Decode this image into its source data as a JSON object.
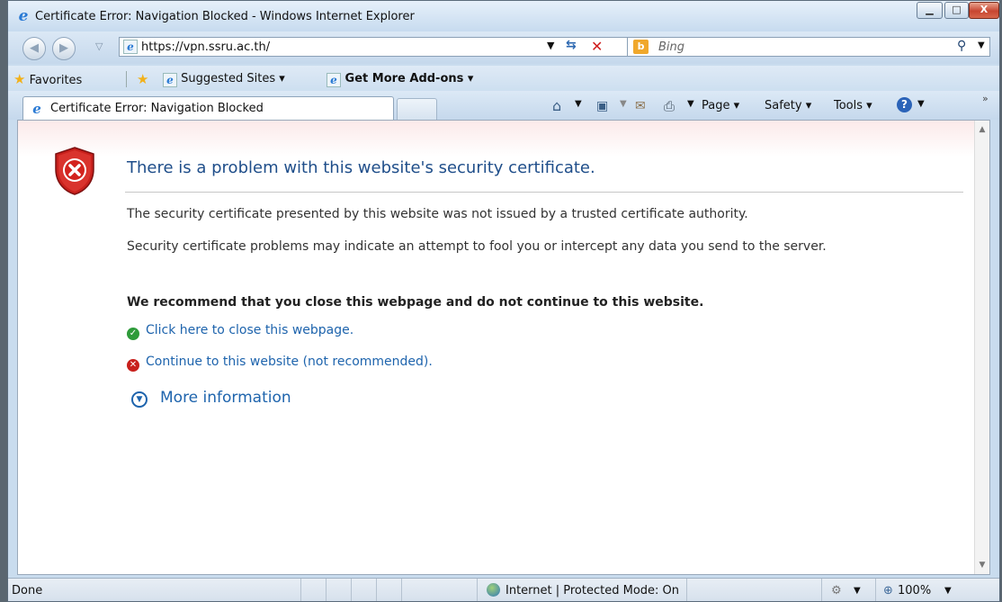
{
  "window": {
    "title": "Certificate Error: Navigation Blocked - Windows Internet Explorer"
  },
  "address_bar": {
    "url": "https://vpn.ssru.ac.th/"
  },
  "search": {
    "placeholder": "Bing"
  },
  "favorites_bar": {
    "favorites_label": "Favorites",
    "suggested_sites_label": "Suggested Sites",
    "addons_label": "Get More Add-ons"
  },
  "tab": {
    "title": "Certificate Error: Navigation Blocked"
  },
  "command_bar": {
    "page_label": "Page",
    "safety_label": "Safety",
    "tools_label": "Tools"
  },
  "page": {
    "heading": "There is a problem with this website's security certificate.",
    "para1": "The security certificate presented by this website was not issued by a trusted certificate authority.",
    "para2": "Security certificate problems may indicate an attempt to fool you or intercept any data you send to the server.",
    "recommendation": "We recommend that you close this webpage and do not continue to this website.",
    "close_link": "Click here to close this webpage.",
    "continue_link": "Continue to this website (not recommended).",
    "more_info": "More information"
  },
  "status_bar": {
    "status": "Done",
    "zone": "Internet | Protected Mode: On",
    "zoom": "100%"
  },
  "colors": {
    "heading": "#1f4e8a",
    "link": "#1e64ad",
    "shield_red": "#c8201c",
    "safe_green": "#2e9b3a"
  }
}
